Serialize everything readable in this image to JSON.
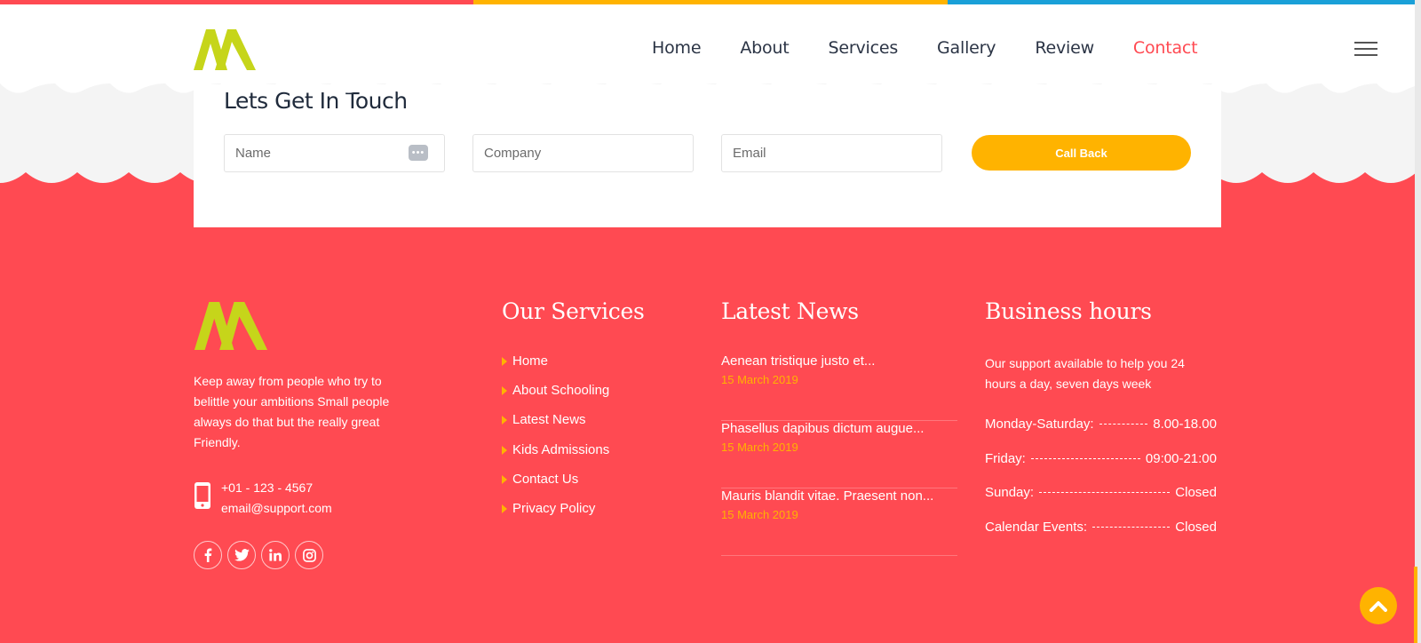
{
  "colors": {
    "red": "#ff4a52",
    "yellow": "#ffb300",
    "blue": "#1aa0d8",
    "lime": "#c6d51a",
    "navy": "#1f2a3b"
  },
  "nav": {
    "items": [
      {
        "label": "Home"
      },
      {
        "label": "About"
      },
      {
        "label": "Services"
      },
      {
        "label": "Gallery"
      },
      {
        "label": "Review"
      },
      {
        "label": "Contact",
        "active": true
      }
    ]
  },
  "contact_form": {
    "title": "Lets Get In Touch",
    "name_placeholder": "Name",
    "company_placeholder": "Company",
    "email_placeholder": "Email",
    "button_label": "Call Back"
  },
  "footer": {
    "about_text": "Keep away from people who try to belittle your ambitions Small people always do that but the really great Friendly.",
    "phone": "+01 - 123 - 4567",
    "email": "email@support.com",
    "socials": [
      "facebook-icon",
      "twitter-icon",
      "linkedin-icon",
      "instagram-icon"
    ],
    "services_title": "Our Services",
    "services": [
      "Home",
      "About Schooling",
      "Latest News",
      "Kids Admissions",
      "Contact Us",
      "Privacy Policy"
    ],
    "news_title": "Latest News",
    "news": [
      {
        "title": "Aenean tristique justo et...",
        "date": "15 March 2019"
      },
      {
        "title": "Phasellus dapibus dictum augue...",
        "date": "15 March 2019"
      },
      {
        "title": "Mauris blandit vitae. Praesent non...",
        "date": "15 March 2019"
      }
    ],
    "hours_title": "Business hours",
    "hours_desc": "Our support available to help you 24 hours a day, seven days week",
    "hours": [
      {
        "day": "Monday-Saturday:",
        "time": "8.00-18.00"
      },
      {
        "day": "Friday:",
        "time": "09:00-21:00"
      },
      {
        "day": "Sunday:",
        "time": "Closed"
      },
      {
        "day": "Calendar Events:",
        "time": "Closed"
      }
    ]
  }
}
